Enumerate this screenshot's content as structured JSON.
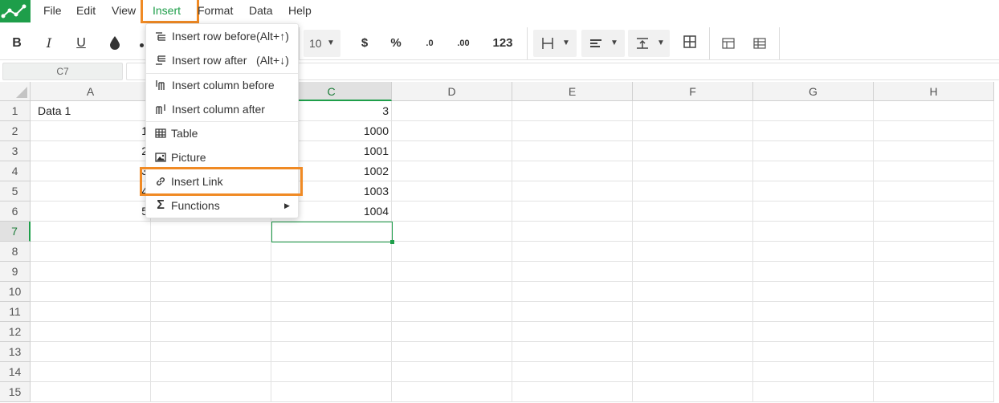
{
  "menubar": {
    "items": [
      "File",
      "Edit",
      "View",
      "Insert",
      "Format",
      "Data",
      "Help"
    ]
  },
  "toolbar": {
    "bold": "B",
    "italic": "I",
    "underline": "U",
    "font_size": "10",
    "currency": "$",
    "percent": "%",
    "dec_decrease": ".0",
    "dec_increase": ".00",
    "number_format": "123"
  },
  "formula_bar": {
    "cell_ref": "C7",
    "value": ""
  },
  "grid": {
    "columns": [
      "A",
      "B",
      "C",
      "D",
      "E",
      "F",
      "G",
      "H"
    ],
    "rows": [
      "1",
      "2",
      "3",
      "4",
      "5",
      "6",
      "7",
      "8",
      "9",
      "10",
      "11",
      "12",
      "13",
      "14",
      "15"
    ],
    "selected_column": "C",
    "selected_row": "7",
    "cells": {
      "A1": "Data 1",
      "A2": "1",
      "A3": "2",
      "A4": "3",
      "A5": "4",
      "A6": "5",
      "C1": "3",
      "C2": "1000",
      "C3": "1001",
      "C4": "1002",
      "C5": "1003",
      "C6": "1004"
    }
  },
  "insert_menu": {
    "items": [
      {
        "label": "Insert row before(Alt+↑)",
        "icon": "insert-row-before-icon"
      },
      {
        "label": "Insert row after   (Alt+↓)",
        "icon": "insert-row-after-icon"
      },
      {
        "label": "Insert column before",
        "icon": "insert-column-before-icon"
      },
      {
        "label": "Insert column after",
        "icon": "insert-column-after-icon"
      },
      {
        "label": "Table",
        "icon": "table-icon"
      },
      {
        "label": "Picture",
        "icon": "picture-icon"
      },
      {
        "label": "Insert Link",
        "icon": "link-icon"
      },
      {
        "label": "Functions",
        "icon": "sigma-icon"
      }
    ]
  },
  "colors": {
    "accent": "#1e9e4a",
    "highlight": "#f08a24"
  }
}
